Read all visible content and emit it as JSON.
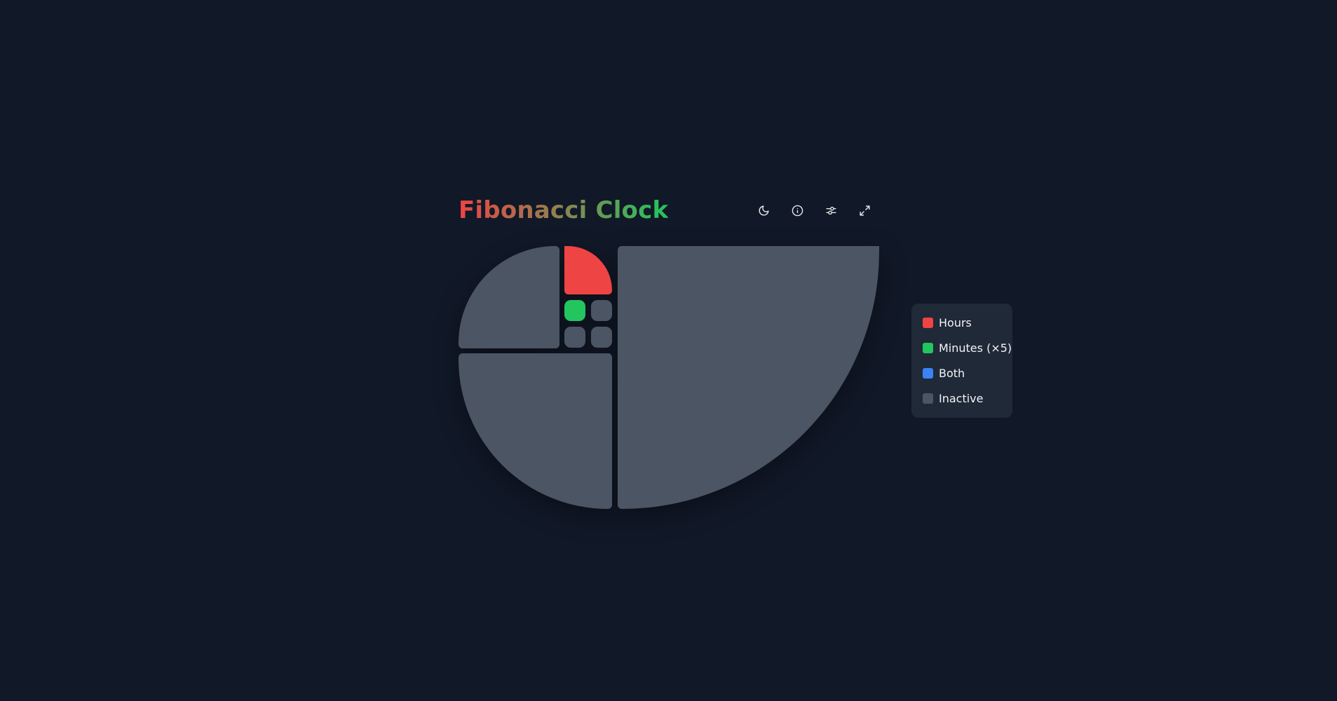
{
  "header": {
    "title_part1": "Fibonacci",
    "title_part2": "Clock"
  },
  "toolbar": {
    "buttons": [
      {
        "name": "theme-toggle-button",
        "icon": "moon-icon"
      },
      {
        "name": "info-button",
        "icon": "info-icon"
      },
      {
        "name": "settings-button",
        "icon": "sliders-icon"
      },
      {
        "name": "fullscreen-button",
        "icon": "expand-icon"
      }
    ]
  },
  "clock": {
    "tiles": [
      {
        "fib": 1,
        "state": "minutes"
      },
      {
        "fib": 1,
        "state": "inactive"
      },
      {
        "fib": 1,
        "state": "inactive"
      },
      {
        "fib": 1,
        "state": "inactive"
      },
      {
        "fib": 2,
        "state": "hours"
      },
      {
        "fib": 3,
        "state": "inactive"
      },
      {
        "fib": 5,
        "state": "inactive"
      },
      {
        "fib": 8,
        "state": "inactive"
      }
    ]
  },
  "legend": {
    "items": [
      {
        "label": "Hours",
        "color": "#ef4444"
      },
      {
        "label": "Minutes (×5)",
        "color": "#22c55e"
      },
      {
        "label": "Both",
        "color": "#3b82f6"
      },
      {
        "label": "Inactive",
        "color": "#4b5563"
      }
    ]
  },
  "colors": {
    "background": "#111827",
    "title_gradient_start": "#ef4444",
    "title_gradient_end": "#22c55e",
    "hours": "#ef4444",
    "minutes": "#22c55e",
    "both": "#3b82f6",
    "inactive": "#4b5563",
    "legend_background": "#1f2937"
  }
}
